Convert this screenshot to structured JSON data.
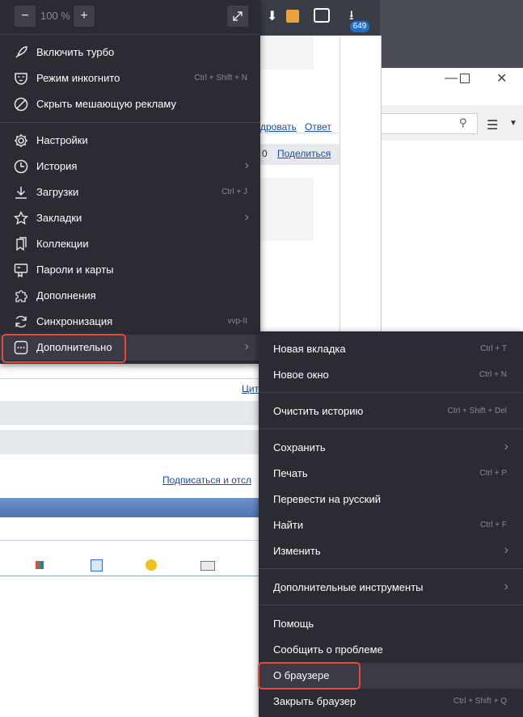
{
  "zoom": {
    "minus": "−",
    "value": "100 %",
    "plus": "+"
  },
  "toolbar": {
    "download_count": "649"
  },
  "background": {
    "link_vote": "дровать",
    "link_reply": "Ответ",
    "counter": "0",
    "link_share": "Поделиться",
    "link_quote": "Цит",
    "link_subscribe": "Подписаться и отсл"
  },
  "main_menu": {
    "turbo": "Включить турбо",
    "incognito": "Режим инкогнито",
    "incognito_shortcut": "Ctrl + Shift + N",
    "block_ads": "Скрыть мешающую рекламу",
    "settings": "Настройки",
    "history": "История",
    "downloads": "Загрузки",
    "downloads_shortcut": "Ctrl + J",
    "bookmarks": "Закладки",
    "collections": "Коллекции",
    "passwords": "Пароли и карты",
    "extensions": "Дополнения",
    "sync": "Синхронизация",
    "sync_user": "vvp-II",
    "more": "Дополнительно"
  },
  "sub_menu": {
    "new_tab": "Новая вкладка",
    "new_tab_shortcut": "Ctrl + T",
    "new_window": "Новое окно",
    "new_window_shortcut": "Ctrl + N",
    "clear_history": "Очистить историю",
    "clear_history_shortcut": "Ctrl + Shift + Del",
    "save": "Сохранить",
    "print": "Печать",
    "print_shortcut": "Ctrl + P",
    "translate": "Перевести на русский",
    "find": "Найти",
    "find_shortcut": "Ctrl + F",
    "edit": "Изменить",
    "more_tools": "Дополнительные инструменты",
    "help": "Помощь",
    "report": "Сообщить о проблеме",
    "about": "О браузере",
    "close": "Закрыть браузер",
    "close_shortcut": "Ctrl + Shift + Q"
  },
  "colors": {
    "menu_bg": "#2b2b33",
    "highlight_border": "#e34a3a",
    "badge": "#1e6fd1"
  }
}
